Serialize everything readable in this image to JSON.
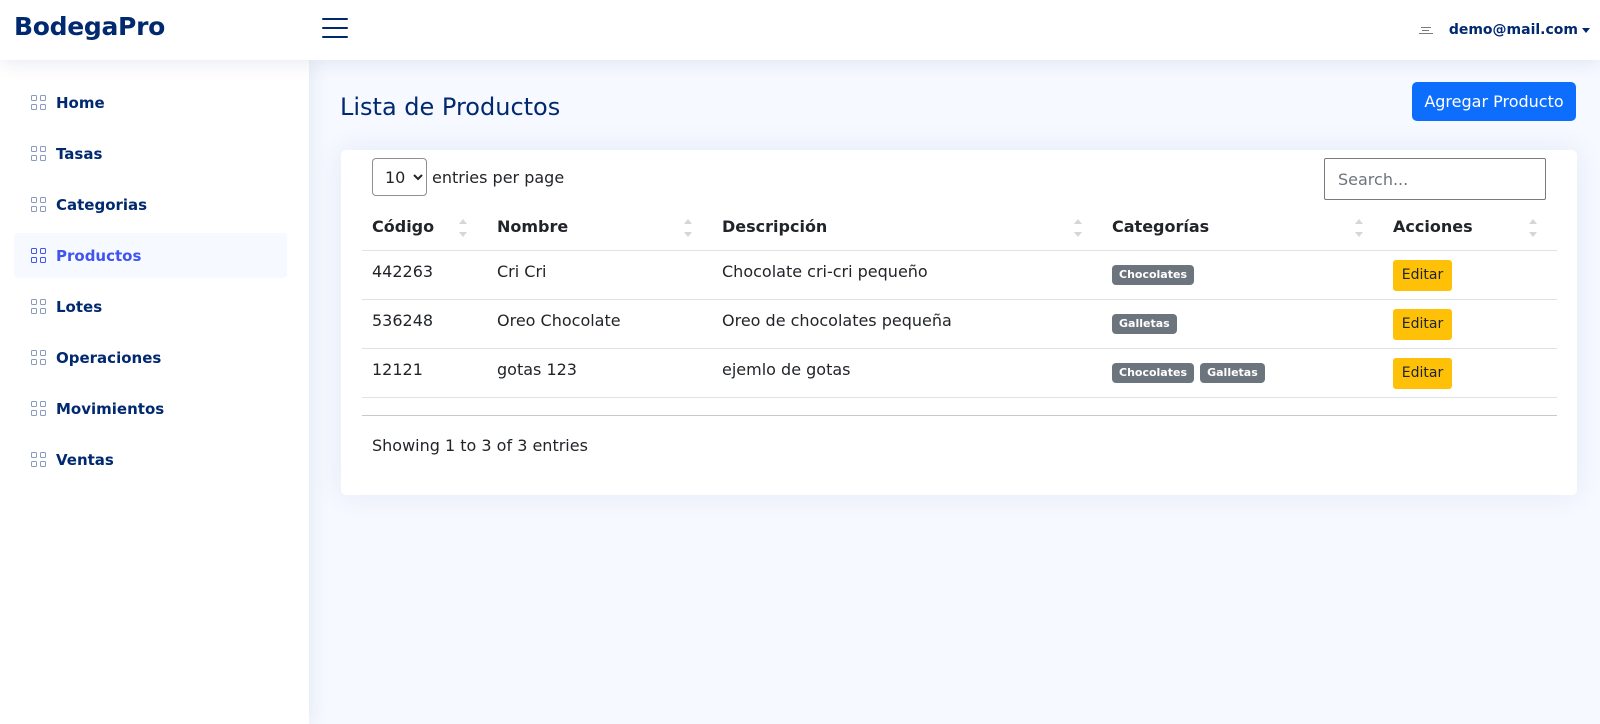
{
  "header": {
    "logo": "BodegaPro",
    "user_email": "demo@mail.com"
  },
  "sidebar": {
    "items": [
      {
        "label": "Home",
        "icon": "grid-icon",
        "active": false
      },
      {
        "label": "Tasas",
        "icon": "grid-icon",
        "active": false
      },
      {
        "label": "Categorias",
        "icon": "grid-icon",
        "active": false
      },
      {
        "label": "Productos",
        "icon": "grid-icon",
        "active": true
      },
      {
        "label": "Lotes",
        "icon": "grid-icon",
        "active": false
      },
      {
        "label": "Operaciones",
        "icon": "grid-icon",
        "active": false
      },
      {
        "label": "Movimientos",
        "icon": "grid-icon",
        "active": false
      },
      {
        "label": "Ventas",
        "icon": "grid-icon",
        "active": false
      }
    ]
  },
  "main": {
    "title": "Lista de Productos",
    "add_button": "Agregar Producto",
    "per_page_value": "10",
    "per_page_label": "entries per page",
    "search_placeholder": "Search...",
    "columns": [
      "Código",
      "Nombre",
      "Descripción",
      "Categorías",
      "Acciones"
    ],
    "rows": [
      {
        "codigo": "442263",
        "nombre": "Cri Cri",
        "descripcion": "Chocolate cri-cri pequeño",
        "categorias": [
          "Chocolates"
        ],
        "accion": "Editar"
      },
      {
        "codigo": "536248",
        "nombre": "Oreo Chocolate",
        "descripcion": "Oreo de chocolates pequeña",
        "categorias": [
          "Galletas"
        ],
        "accion": "Editar"
      },
      {
        "codigo": "12121",
        "nombre": "gotas 123",
        "descripcion": "ejemlo de gotas",
        "categorias": [
          "Chocolates",
          "Galletas"
        ],
        "accion": "Editar"
      }
    ],
    "info": "Showing 1 to 3 of 3 entries"
  },
  "colors": {
    "brand": "#012970",
    "primary": "#0d6efd",
    "warning": "#ffc107",
    "badge": "#6c757d",
    "active_nav": "#4154f1"
  }
}
